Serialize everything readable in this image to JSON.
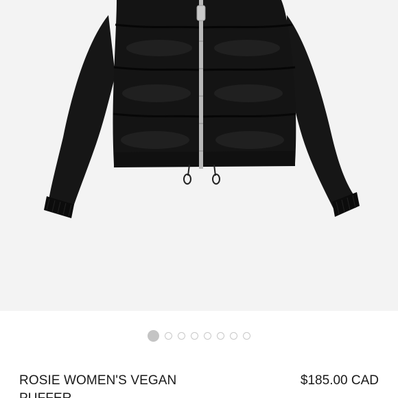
{
  "product": {
    "image_icon": "puffer-jacket-image",
    "name": "ROSIE WOMEN'S VEGAN PUFFER",
    "price": "$185.00 CAD"
  },
  "carousel": {
    "total_slides": 8,
    "active_index": 0
  },
  "colors": {
    "hero_background": "#f3f3f3",
    "jacket": "#141414",
    "zipper": "#b9b9b9",
    "dot_active": "#c4c4c4",
    "dot_border": "#c8c8c8"
  }
}
